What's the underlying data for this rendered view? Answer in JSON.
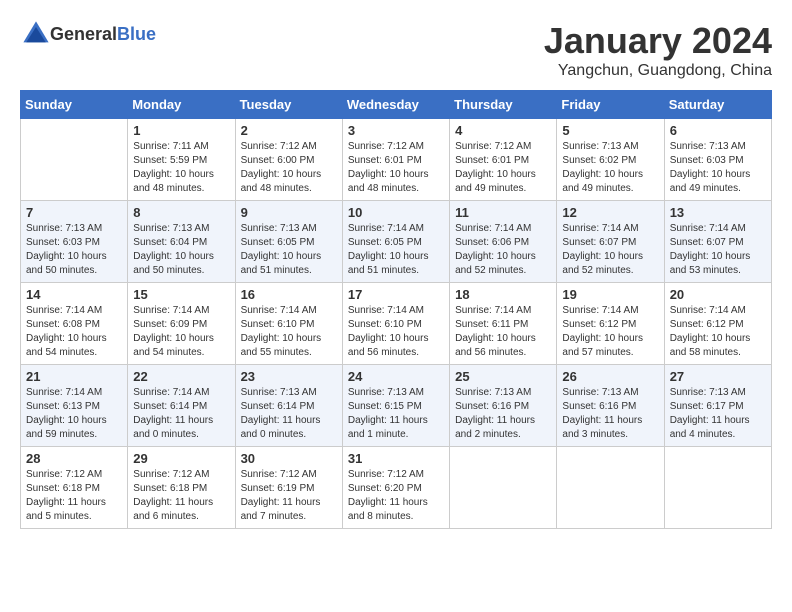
{
  "header": {
    "logo_general": "General",
    "logo_blue": "Blue",
    "month": "January 2024",
    "location": "Yangchun, Guangdong, China"
  },
  "columns": [
    "Sunday",
    "Monday",
    "Tuesday",
    "Wednesday",
    "Thursday",
    "Friday",
    "Saturday"
  ],
  "weeks": [
    [
      {
        "day": "",
        "info": ""
      },
      {
        "day": "1",
        "info": "Sunrise: 7:11 AM\nSunset: 5:59 PM\nDaylight: 10 hours\nand 48 minutes."
      },
      {
        "day": "2",
        "info": "Sunrise: 7:12 AM\nSunset: 6:00 PM\nDaylight: 10 hours\nand 48 minutes."
      },
      {
        "day": "3",
        "info": "Sunrise: 7:12 AM\nSunset: 6:01 PM\nDaylight: 10 hours\nand 48 minutes."
      },
      {
        "day": "4",
        "info": "Sunrise: 7:12 AM\nSunset: 6:01 PM\nDaylight: 10 hours\nand 49 minutes."
      },
      {
        "day": "5",
        "info": "Sunrise: 7:13 AM\nSunset: 6:02 PM\nDaylight: 10 hours\nand 49 minutes."
      },
      {
        "day": "6",
        "info": "Sunrise: 7:13 AM\nSunset: 6:03 PM\nDaylight: 10 hours\nand 49 minutes."
      }
    ],
    [
      {
        "day": "7",
        "info": "Sunrise: 7:13 AM\nSunset: 6:03 PM\nDaylight: 10 hours\nand 50 minutes."
      },
      {
        "day": "8",
        "info": "Sunrise: 7:13 AM\nSunset: 6:04 PM\nDaylight: 10 hours\nand 50 minutes."
      },
      {
        "day": "9",
        "info": "Sunrise: 7:13 AM\nSunset: 6:05 PM\nDaylight: 10 hours\nand 51 minutes."
      },
      {
        "day": "10",
        "info": "Sunrise: 7:14 AM\nSunset: 6:05 PM\nDaylight: 10 hours\nand 51 minutes."
      },
      {
        "day": "11",
        "info": "Sunrise: 7:14 AM\nSunset: 6:06 PM\nDaylight: 10 hours\nand 52 minutes."
      },
      {
        "day": "12",
        "info": "Sunrise: 7:14 AM\nSunset: 6:07 PM\nDaylight: 10 hours\nand 52 minutes."
      },
      {
        "day": "13",
        "info": "Sunrise: 7:14 AM\nSunset: 6:07 PM\nDaylight: 10 hours\nand 53 minutes."
      }
    ],
    [
      {
        "day": "14",
        "info": "Sunrise: 7:14 AM\nSunset: 6:08 PM\nDaylight: 10 hours\nand 54 minutes."
      },
      {
        "day": "15",
        "info": "Sunrise: 7:14 AM\nSunset: 6:09 PM\nDaylight: 10 hours\nand 54 minutes."
      },
      {
        "day": "16",
        "info": "Sunrise: 7:14 AM\nSunset: 6:10 PM\nDaylight: 10 hours\nand 55 minutes."
      },
      {
        "day": "17",
        "info": "Sunrise: 7:14 AM\nSunset: 6:10 PM\nDaylight: 10 hours\nand 56 minutes."
      },
      {
        "day": "18",
        "info": "Sunrise: 7:14 AM\nSunset: 6:11 PM\nDaylight: 10 hours\nand 56 minutes."
      },
      {
        "day": "19",
        "info": "Sunrise: 7:14 AM\nSunset: 6:12 PM\nDaylight: 10 hours\nand 57 minutes."
      },
      {
        "day": "20",
        "info": "Sunrise: 7:14 AM\nSunset: 6:12 PM\nDaylight: 10 hours\nand 58 minutes."
      }
    ],
    [
      {
        "day": "21",
        "info": "Sunrise: 7:14 AM\nSunset: 6:13 PM\nDaylight: 10 hours\nand 59 minutes."
      },
      {
        "day": "22",
        "info": "Sunrise: 7:14 AM\nSunset: 6:14 PM\nDaylight: 11 hours\nand 0 minutes."
      },
      {
        "day": "23",
        "info": "Sunrise: 7:13 AM\nSunset: 6:14 PM\nDaylight: 11 hours\nand 0 minutes."
      },
      {
        "day": "24",
        "info": "Sunrise: 7:13 AM\nSunset: 6:15 PM\nDaylight: 11 hours\nand 1 minute."
      },
      {
        "day": "25",
        "info": "Sunrise: 7:13 AM\nSunset: 6:16 PM\nDaylight: 11 hours\nand 2 minutes."
      },
      {
        "day": "26",
        "info": "Sunrise: 7:13 AM\nSunset: 6:16 PM\nDaylight: 11 hours\nand 3 minutes."
      },
      {
        "day": "27",
        "info": "Sunrise: 7:13 AM\nSunset: 6:17 PM\nDaylight: 11 hours\nand 4 minutes."
      }
    ],
    [
      {
        "day": "28",
        "info": "Sunrise: 7:12 AM\nSunset: 6:18 PM\nDaylight: 11 hours\nand 5 minutes."
      },
      {
        "day": "29",
        "info": "Sunrise: 7:12 AM\nSunset: 6:18 PM\nDaylight: 11 hours\nand 6 minutes."
      },
      {
        "day": "30",
        "info": "Sunrise: 7:12 AM\nSunset: 6:19 PM\nDaylight: 11 hours\nand 7 minutes."
      },
      {
        "day": "31",
        "info": "Sunrise: 7:12 AM\nSunset: 6:20 PM\nDaylight: 11 hours\nand 8 minutes."
      },
      {
        "day": "",
        "info": ""
      },
      {
        "day": "",
        "info": ""
      },
      {
        "day": "",
        "info": ""
      }
    ]
  ]
}
